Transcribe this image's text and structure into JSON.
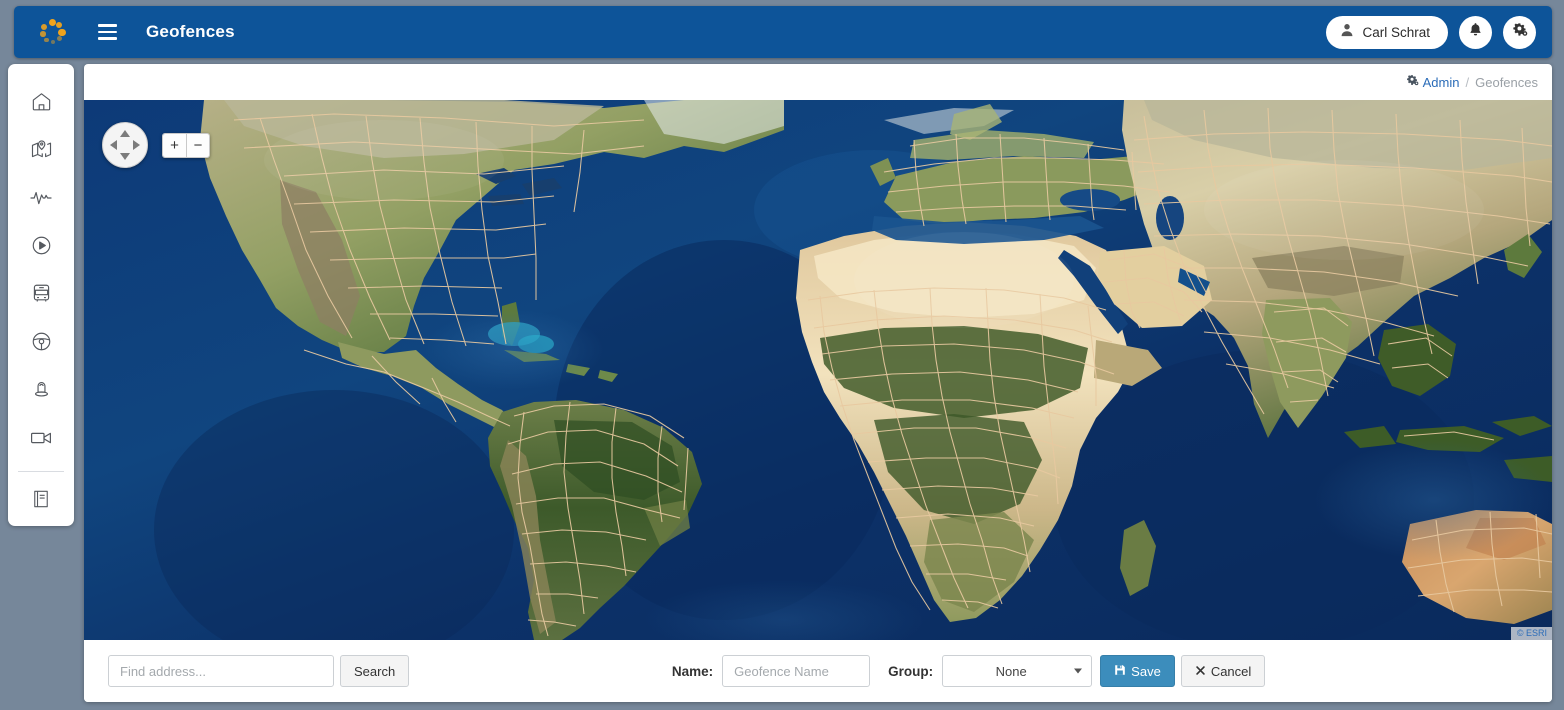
{
  "header": {
    "logo_icon": "spinner-dots-logo",
    "menu_icon": "hamburger-icon",
    "title": "Geofences",
    "user": {
      "name": "Carl Schrat",
      "icon": "person-icon"
    },
    "notifications_icon": "bell-icon",
    "settings_icon": "gears-icon",
    "background_color": "#0d5499"
  },
  "sidebar": {
    "items": [
      {
        "name": "home",
        "icon": "home-icon"
      },
      {
        "name": "map",
        "icon": "map-pin-icon"
      },
      {
        "name": "activity",
        "icon": "pulse-icon"
      },
      {
        "name": "playback",
        "icon": "play-circle-icon"
      },
      {
        "name": "vehicles",
        "icon": "bus-icon"
      },
      {
        "name": "drivers",
        "icon": "steering-wheel-icon"
      },
      {
        "name": "passengers",
        "icon": "person-pin-icon"
      },
      {
        "name": "cameras",
        "icon": "video-camera-icon"
      }
    ],
    "footer_items": [
      {
        "name": "manual",
        "icon": "book-icon"
      }
    ]
  },
  "breadcrumb": {
    "icon": "gears-icon",
    "root": "Admin",
    "separator": "/",
    "current": "Geofences"
  },
  "map": {
    "pan_control": "pan-control",
    "zoom_in_label": "+",
    "zoom_out_label": "−",
    "attribution": "© ESRI"
  },
  "toolbar": {
    "address_placeholder": "Find address...",
    "address_value": "",
    "search_label": "Search",
    "name_label": "Name:",
    "name_placeholder": "Geofence Name",
    "name_value": "",
    "group_label": "Group:",
    "group_selected": "None",
    "group_options": [
      "None"
    ],
    "save_label": "Save",
    "save_icon": "floppy-disk-icon",
    "cancel_label": "Cancel",
    "cancel_icon": "x-icon",
    "save_color": "#3c8dbc"
  }
}
